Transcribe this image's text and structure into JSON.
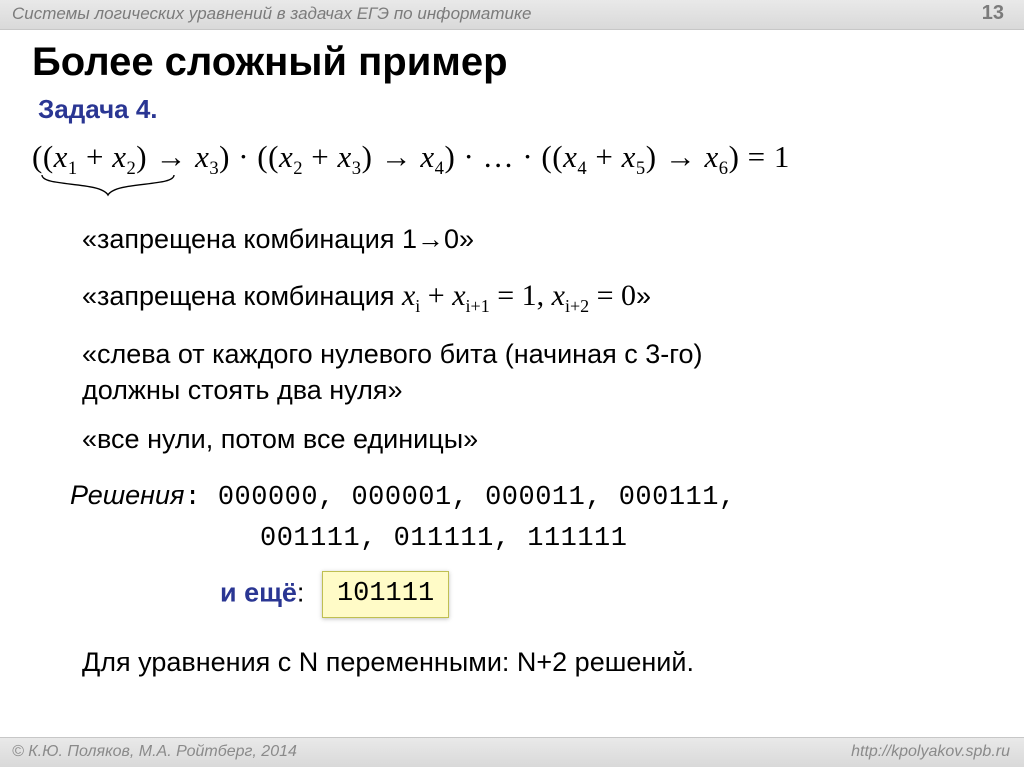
{
  "header": {
    "breadcrumb": "Системы логических уравнений в задачах ЕГЭ по информатике",
    "page": "13"
  },
  "title": "Более сложный пример",
  "task": "Задача 4.",
  "equation": {
    "open": "((",
    "x1": "x",
    "s1": "1",
    "plus": " + ",
    "x2": "x",
    "s2": "2",
    "closeimp": ") → ",
    "x3": "x",
    "s3": "3",
    "dotopen": ") · ((",
    "x2b": "x",
    "s2b": "2",
    "x3b": "x",
    "s3b": "3",
    "x4": "x",
    "s4": "4",
    "dots": ") · … · ((",
    "x4b": "x",
    "s4b": "4",
    "x5": "x",
    "s5": "5",
    "x6": "x",
    "s6": "6",
    "end": ") = 1"
  },
  "notes": {
    "n1": "«запрещена комбинация 1→0»",
    "n2a": "«запрещена комбинация  ",
    "n2b_x": "x",
    "n2b_i": "i",
    "n2b_plus": " + ",
    "n2b_x2": "x",
    "n2b_i1": "i+1",
    "n2b_eq1": " = 1,   ",
    "n2b_x3": "x",
    "n2b_i2": "i+2",
    "n2b_eq0": " = 0",
    "n2c": "»",
    "n3a": "«слева от каждого нулевого бита (начиная с 3-го)",
    "n3b": "  должны стоять два нуля»",
    "n4": "«все нули, потом все единицы»",
    "sol_label": "Решения",
    "sol_line1": ": 000000, 000001, 000011, 000111,",
    "sol_line2": "001111, 011111, 111111",
    "extra_label": "и ещё",
    "extra_colon": ":",
    "extra_value": "101111",
    "final": "Для уравнения с N переменными: N+2 решений."
  },
  "footer": {
    "copyright": "© К.Ю. Поляков, М.А. Ройтберг, 2014",
    "url": "http://kpolyakov.spb.ru"
  }
}
